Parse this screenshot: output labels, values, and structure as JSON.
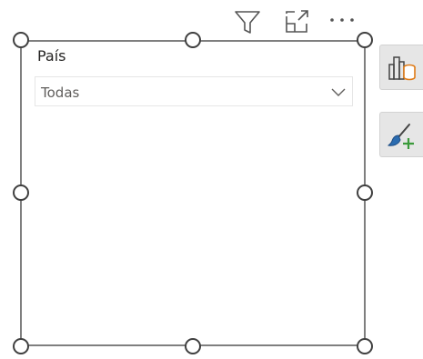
{
  "header": {
    "icons": [
      "filter-icon",
      "focus-mode-icon",
      "more-options-icon"
    ]
  },
  "slicer": {
    "title": "País",
    "dropdown_value": "Todas"
  },
  "side_panel": {
    "icons": [
      "build-visual-icon",
      "format-visual-icon"
    ]
  },
  "colors": {
    "accent_orange": "#e07b16",
    "accent_blue": "#2b6cb0",
    "accent_green": "#3a9a3a",
    "frame_border": "#7f7f7f"
  }
}
